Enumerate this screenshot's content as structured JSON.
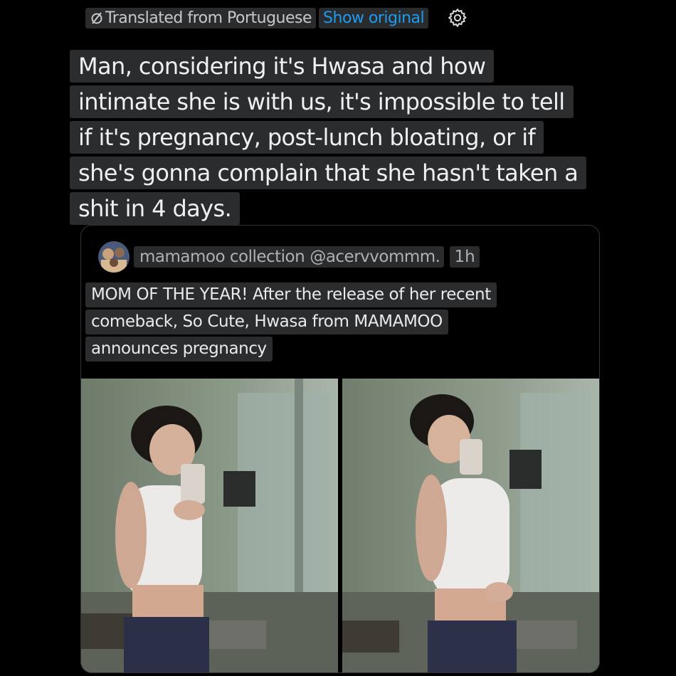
{
  "translation": {
    "icon": "translate-icon",
    "label": "Translated from Portuguese",
    "show_original": "Show original",
    "settings_icon": "gear-icon"
  },
  "tweet": {
    "lines": [
      "Man, considering it's Hwasa and how",
      "intimate she is with us, it's impossible to tell",
      "if it's pregnancy, post-lunch bloating, or if",
      "she's gonna complain that she hasn't taken a",
      "shit in 4 days."
    ]
  },
  "quote": {
    "display_name": "mamamoo collection",
    "handle": "@acervvommm.",
    "time": "1h",
    "lines": [
      "MOM OF THE YEAR! After the release of her recent",
      "comeback, So Cute, Hwasa from MAMAMOO",
      "announces pregnancy"
    ]
  },
  "colors": {
    "background": "#000000",
    "link": "#1d9bf0",
    "highlight": "#2b2c2e"
  }
}
